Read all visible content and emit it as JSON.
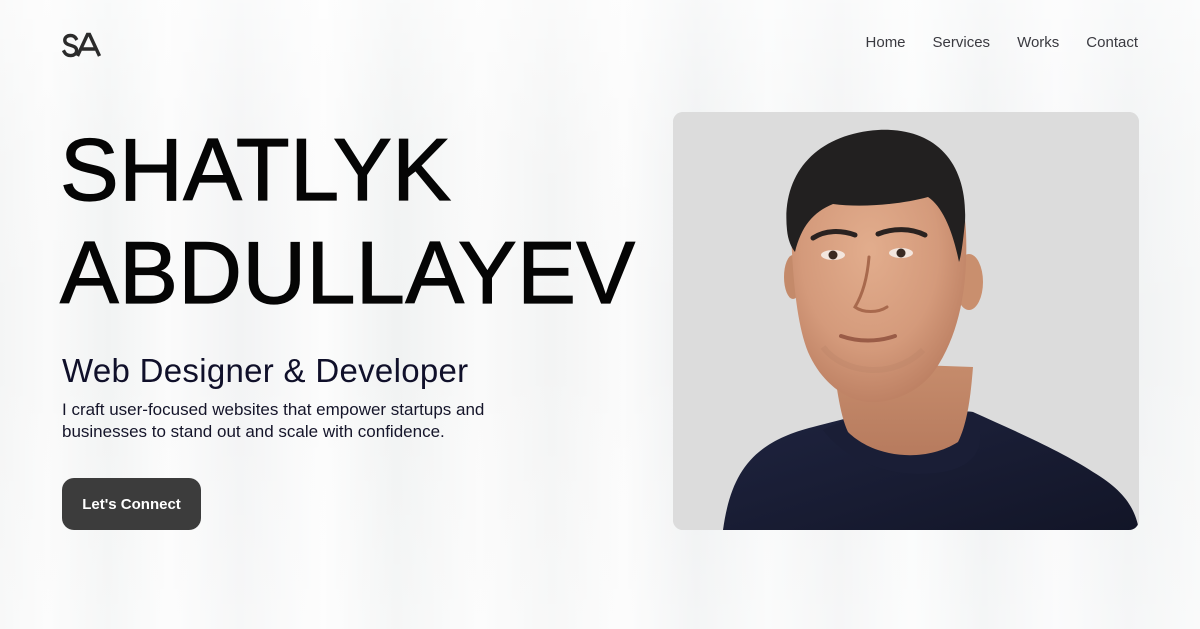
{
  "header": {
    "logo_text": "SA",
    "nav": [
      {
        "label": "Home"
      },
      {
        "label": "Services"
      },
      {
        "label": "Works"
      },
      {
        "label": "Contact"
      }
    ]
  },
  "hero": {
    "name_line1": "SHATLYK",
    "name_line2": "ABDULLAYEV",
    "role": "Web Designer & Developer",
    "tagline": "I craft user-focused websites that empower startups and businesses to stand out and scale with confidence.",
    "cta_label": "Let's Connect"
  },
  "colors": {
    "button_bg": "#3c3c3c",
    "heading_text": "#050505",
    "photo_bg": "#dcdcdc"
  }
}
